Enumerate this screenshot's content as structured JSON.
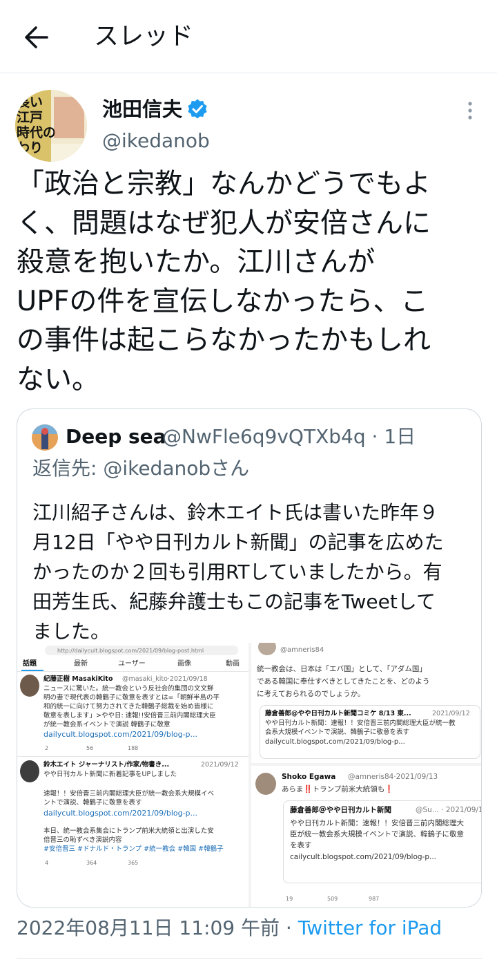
{
  "header": {
    "title": "スレッド"
  },
  "tweet": {
    "author_name": "池田信夫",
    "handle": "@ikedanob",
    "text": "「政治と宗教」なんかどうでもよ\nく、問題はなぜ犯人が安倍さんに\n殺意を抱いたか。江川さんが\nUPFの件を宣伝しなかったら、こ\nの事件は起こらなかったかもしれ\nない。",
    "timestamp": "2022年08月11日 11:09 午前",
    "separator": " · ",
    "source_app": "Twitter for iPad"
  },
  "avatar_text": [
    "長い",
    "江戸",
    "時代の",
    "わり"
  ],
  "quote": {
    "name": "Deep sea",
    "meta": "@NwFle6q9vQTXb4q · 1日",
    "reply_to": "返信先: @ikedanobさん",
    "text": "江川紹子さんは、鈴木エイト氏は書いた昨年９\n月12日「やや日刊カルト新聞」の記事を広めた\nかったのか２回も引用RTしていましたから。有\n田芳生氏、紀藤弁護士もこの記事をTweetして\nました。"
  },
  "shot_left": {
    "url": "http://dailycult.blogspot.com/2021/09/blog-post.html",
    "tabs": [
      "話題",
      "最新",
      "ユーザー",
      "画像",
      "動画"
    ],
    "t1_name": "紀藤正樹 MasakiKito",
    "t1_meta": "@masaki_kito·2021/09/18",
    "t1_lines": [
      "ニュースに驚いた。統一教会という反社会的集団の文文鮮",
      "明の妻で現代表の韓鶴子に敬意を表すとは=「朝鮮半島の平",
      "和的統一に向けて努力されてきた韓鶴子総裁を始め皆様に",
      "敬意を表します」>やや日: 速報!!安倍晋三前内閣総理大臣",
      "が統一教会系イベントで演説 韓鶴子に敬意"
    ],
    "t1_link": "dailycult.blogspot.com/2021/09/blog-p...",
    "t1_stats": [
      "2",
      "56",
      "188"
    ],
    "t2_name": "鈴木エイト ジャーナリスト/作家/物書き...",
    "t2_meta": "2021/09/12",
    "t2_line": "やや日刊カルト新聞に新着記事をUPしました",
    "t2_body": [
      "速報！！安倍晋三前内閣総理大臣が統一教会系大規模イベ",
      "ントで演説、韓鶴子に敬意を表す"
    ],
    "t2_link": "dailycult.blogspot.com/2021/09/blog-p...",
    "t2_body2": [
      "本日、統一教会系集会にトランプ前米大統領と出演した安",
      "倍晋三の恥ずべき演説内容"
    ],
    "t2_tags": "#安倍晋三 #ドナルド・トランプ #統一教会 #韓国 #韓鶴子",
    "t2_stats": [
      "4",
      "364",
      "365"
    ]
  },
  "shot_right_top": {
    "handle": "@amneris84",
    "lines": [
      "統一教会は、日本は「エバ国」として、「アダム国」",
      "である韓国に奉仕すべきとしてきたことを、どのよう",
      "に考えておられるのでしょうか。"
    ],
    "card_name": "藤倉善郎@やや日刊カルト新聞コミケ 8/13 東...",
    "card_meta": "2021/09/12",
    "card_lines": [
      "やや日刊カルト新聞：速報！！安倍晋三前内閣総理大臣が統一教",
      "会系大規模イベントで演説、韓鶴子に敬意を表す"
    ],
    "card_link": "dailycult.blogspot.com/2021/09/blog-p..."
  },
  "shot_right_bottom": {
    "name": "Shoko Egawa",
    "meta": "@amneris84·2021/09/13",
    "text": "あらま‼️トランプ前米大統領も❗️",
    "card_name": "藤倉善郎＠やや日刊カルト新聞",
    "card_meta": "@Su... · 2021/09/1",
    "card_lines": [
      "やや日刊カルト新聞：速報！！安倍晋三前内閣総理大",
      "臣が統一教会系大規模イベントで演説、韓鶴子に敬意",
      "を表す"
    ],
    "card_link": "cailycult.blogspot.com/2021/09/blog-p...",
    "stats": [
      "19",
      "509",
      "987"
    ]
  },
  "colors": {
    "accent": "#1d9bf0",
    "secondary": "#536471",
    "text": "#0f1419",
    "border": "#cfd9de"
  },
  "icons": [
    "back-arrow-icon",
    "verified-badge-icon",
    "more-vertical-icon"
  ]
}
